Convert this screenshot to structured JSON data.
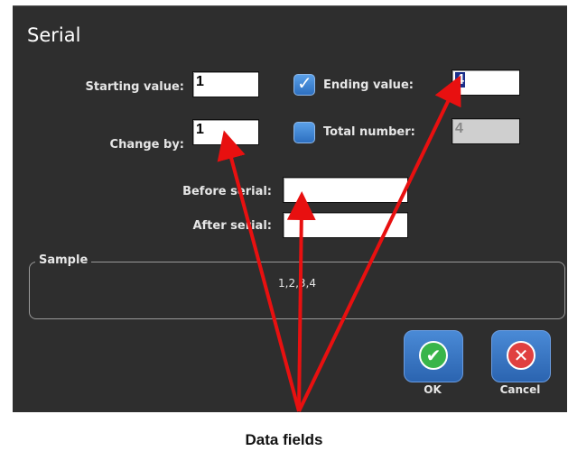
{
  "dialog": {
    "title": "Serial",
    "starting_value_label": "Starting value:",
    "starting_value": "1",
    "ending_value_checkbox_label": "Ending value:",
    "ending_value": "4",
    "ending_value_checked": true,
    "change_by_label": "Change by:",
    "change_by": "1",
    "total_number_checkbox_label": "Total number:",
    "total_number": "4",
    "total_number_checked": false,
    "before_serial_label": "Before serial:",
    "before_serial": "",
    "after_serial_label": "After serial:",
    "after_serial": "",
    "sample_title": "Sample",
    "sample_value": "1,2,3,4",
    "ok_label": "OK",
    "cancel_label": "Cancel"
  },
  "caption": "Data fields",
  "colors": {
    "panel": "#2e2e2e",
    "arrow": "#e81010",
    "button": "#3b78c8",
    "ok_icon": "#39b54a",
    "cancel_icon": "#e04040"
  }
}
